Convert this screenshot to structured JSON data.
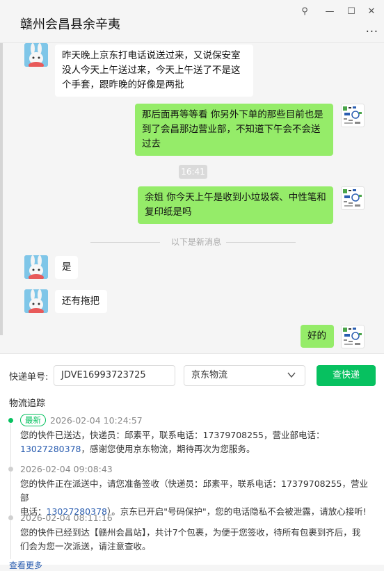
{
  "window": {
    "title": "赣州会昌县余辛夷",
    "pin_icon": "⚲",
    "minimize_icon": "—",
    "maximize_icon": "☐",
    "close_icon": "✕",
    "more_icon": "..."
  },
  "chat": {
    "messages": [
      {
        "side": "left",
        "text": "昨天晚上京东打电话说送过来，又说保安室没人今天上午送过来，今天上午送了不是这个手套，跟昨晚的好像是两批"
      },
      {
        "side": "right",
        "text": "那后面再等等看  你另外下单的那些目前也是到了会昌那边营业部，不知道下午会不会送过去"
      },
      {
        "side": "right",
        "text": "余姐  你今天上午是收到小垃圾袋、中性笔和复印纸是吗"
      },
      {
        "side": "left",
        "text": "是"
      },
      {
        "side": "left",
        "text": "还有拖把"
      },
      {
        "side": "right",
        "text": "好的"
      }
    ],
    "time_badge": "16:41",
    "new_messages_divider": "以下是新消息"
  },
  "tracking": {
    "number_label": "快递单号:",
    "number_value": "JDVE16993723725",
    "carrier_value": "京东物流",
    "query_button": "查快递",
    "section_title": "物流追踪",
    "events": [
      {
        "badge": "最新",
        "time": "2026-02-04 10:24:57",
        "line1": "您的快件已送达，快递员：邱素平，联系电话：17379708255，营业部电话：",
        "phone": "13027280378",
        "line2": "，感谢您使用京东物流，期待再次为您服务。"
      },
      {
        "time": "2026-02-04 09:08:43",
        "line1": "您的快件正在派送中，请您准备签收（快递员：邱素平，联系电话：17379708255，营业部",
        "line2_prefix": "电话：",
        "phone": "13027280378",
        "line2": "）。京东已开启\"号码保护\"，您的电话隐私不会被泄露，请放心接听!"
      },
      {
        "time": "2026-02-04 08:11:16",
        "line1": "您的快件已经到达【赣州会昌站】，共计7个包裹，为便于您签收，待所有包裹到齐后，我",
        "line2": "们会为您一次派送，请注意查收。"
      }
    ],
    "more_link": "查看更多"
  },
  "colors": {
    "accent_green": "#07c160",
    "bubble_green": "#95ec69",
    "link_blue": "#2a5db0"
  }
}
